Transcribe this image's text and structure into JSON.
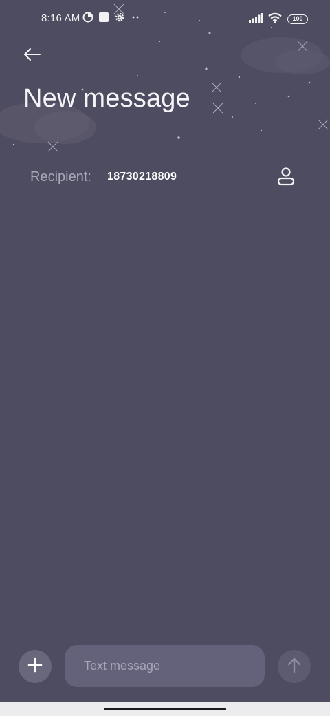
{
  "status_bar": {
    "time": "8:16 AM",
    "battery": "100",
    "icons": [
      "data-saver-icon",
      "square-notification-icon",
      "gear-icon",
      "more-dots-icon",
      "signal-icon",
      "wifi-icon",
      "battery-icon"
    ]
  },
  "header": {
    "title": "New message",
    "back_icon": "arrow-left-icon"
  },
  "recipient": {
    "label": "Recipient:",
    "value": "18730218809",
    "contact_icon": "contact-person-icon"
  },
  "composer": {
    "placeholder": "Text message",
    "value": "",
    "attach_icon": "plus-icon",
    "send_icon": "arrow-up-icon"
  },
  "colors": {
    "background": "#4e4c60",
    "input_background": "#64627a",
    "button_background": "#69677c",
    "title_text": "#f4f4f6",
    "muted_text": "#a9a7b7"
  }
}
